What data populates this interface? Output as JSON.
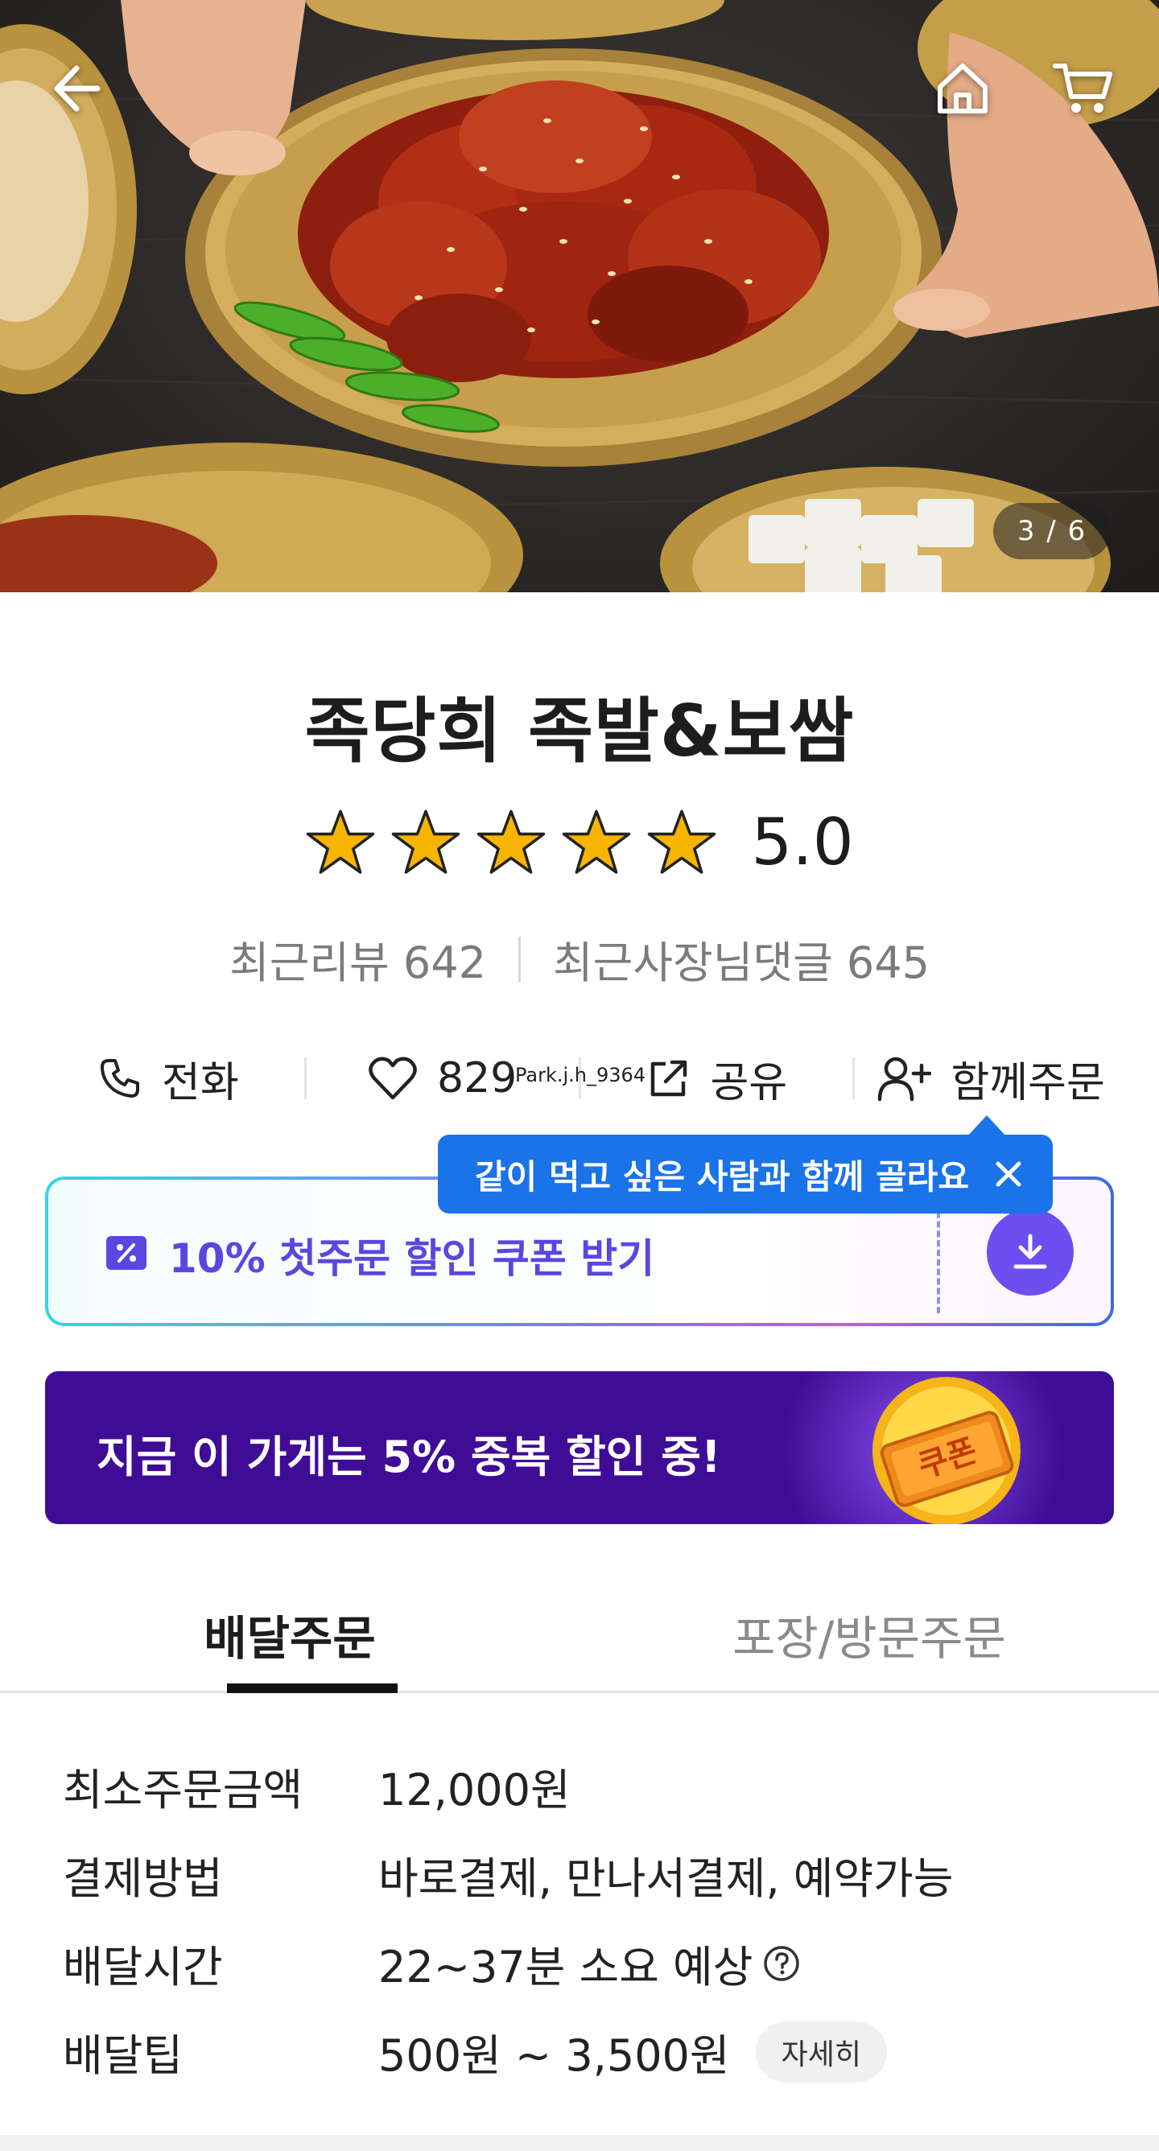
{
  "hero": {
    "counter": "3 / 6",
    "icons": {
      "back": "arrow-left-icon",
      "home": "home-icon",
      "cart": "cart-icon"
    }
  },
  "store": {
    "name": "족당희 족발&보쌈",
    "rating": "5.0",
    "stars": 5,
    "recent_reviews": "최근리뷰 642",
    "owner_replies": "최근사장님댓글 645"
  },
  "actions": {
    "call": "전화",
    "likes": "829",
    "share": "공유",
    "group_order": "함께주문",
    "watermark": "Park.j.h_9364"
  },
  "tooltip": {
    "text": "같이 먹고 싶은 사람과 함께 골라요"
  },
  "coupon": {
    "text": "10% 첫주문 할인 쿠폰 받기"
  },
  "promo": {
    "text": "지금 이 가게는 5% 중복 할인 중!",
    "badge": "쿠폰"
  },
  "tabs": {
    "delivery": "배달주문",
    "pickup": "포장/방문주문"
  },
  "info": {
    "min_order_label": "최소주문금액",
    "min_order_value": "12,000원",
    "payment_label": "결제방법",
    "payment_value": "바로결제, 만나서결제, 예약가능",
    "delivery_time_label": "배달시간",
    "delivery_time_value": "22~37분 소요 예상",
    "delivery_tip_label": "배달팁",
    "delivery_tip_value": "500원 ~ 3,500원",
    "detail_button": "자세히"
  },
  "colors": {
    "accent_purple": "#5b46e0",
    "tooltip_blue": "#1a73e8",
    "promo_bg": "#3f0d95",
    "star": "#f7b500"
  }
}
